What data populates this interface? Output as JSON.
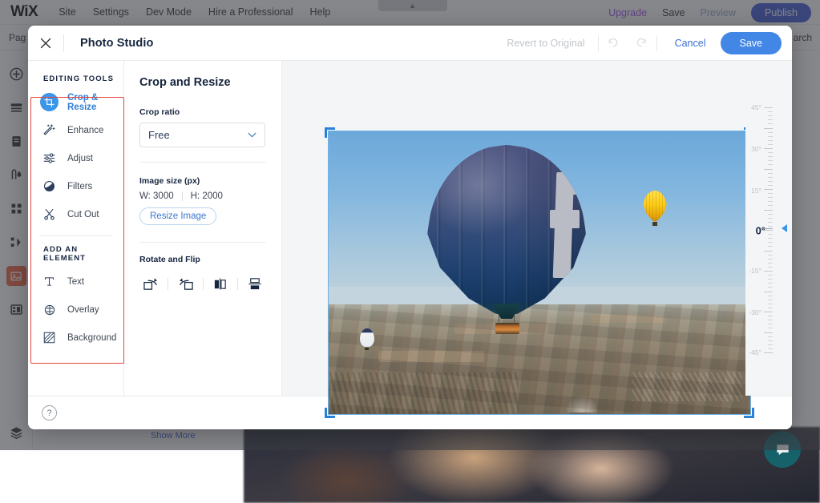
{
  "wix_editor": {
    "logo": "WiX",
    "menu": [
      {
        "label": "Site"
      },
      {
        "label": "Settings"
      },
      {
        "label": "Dev Mode"
      },
      {
        "label": "Hire a Professional"
      },
      {
        "label": "Help"
      }
    ],
    "upgrade_label": "Upgrade",
    "save_label": "Save",
    "preview_label": "Preview",
    "publish_label": "Publish",
    "pages_label": "Pag",
    "search_label": "arch",
    "show_more_label": "Show More",
    "rail_icons": [
      {
        "name": "add-icon"
      },
      {
        "name": "sections-icon"
      },
      {
        "name": "pages-icon"
      },
      {
        "name": "theme-icon"
      },
      {
        "name": "apps-icon"
      },
      {
        "name": "dev-icon"
      },
      {
        "name": "media-icon",
        "active": true
      },
      {
        "name": "layout-icon"
      }
    ]
  },
  "photo_studio": {
    "title": "Photo Studio",
    "close_label": "✕",
    "revert_label": "Revert to Original",
    "undo_label": "Undo",
    "redo_label": "Redo",
    "cancel_label": "Cancel",
    "save_label": "Save",
    "help_label": "?",
    "tools": {
      "editing_tools_heading": "EDITING TOOLS",
      "editing_tools": [
        {
          "label": "Crop & Resize",
          "icon": "crop-icon",
          "active": true
        },
        {
          "label": "Enhance",
          "icon": "magic-wand-icon",
          "active": false
        },
        {
          "label": "Adjust",
          "icon": "sliders-icon",
          "active": false
        },
        {
          "label": "Filters",
          "icon": "filters-icon",
          "active": false
        },
        {
          "label": "Cut Out",
          "icon": "scissors-icon",
          "active": false
        }
      ],
      "add_element_heading": "ADD AN ELEMENT",
      "add_elements": [
        {
          "label": "Text",
          "icon": "text-icon"
        },
        {
          "label": "Overlay",
          "icon": "overlay-icon"
        },
        {
          "label": "Background",
          "icon": "background-icon"
        }
      ]
    },
    "options": {
      "panel_title": "Crop and Resize",
      "crop_ratio_label": "Crop ratio",
      "crop_ratio_value": "Free",
      "image_size_label": "Image size (px)",
      "width_value": "W: 3000",
      "height_value": "H: 2000",
      "resize_button": "Resize Image",
      "rotate_flip_label": "Rotate and Flip",
      "rotate_flip_buttons": [
        {
          "name": "rotate-right-icon"
        },
        {
          "name": "rotate-left-icon"
        },
        {
          "name": "flip-horizontal-icon"
        },
        {
          "name": "flip-vertical-icon"
        }
      ]
    },
    "rotation": {
      "current_value": "0°",
      "labels": [
        "45°",
        "30°",
        "15°",
        "0°",
        "-15°",
        "-30°",
        "-45°"
      ]
    }
  },
  "colors": {
    "accent_blue": "#4287e6",
    "tool_active_blue": "#2f7ed4",
    "publish_blue": "#3753d4",
    "highlight_red": "#e8433f",
    "upgrade_purple": "#9a4df0",
    "media_orange": "#f0603c",
    "chat_teal": "#16626b"
  }
}
